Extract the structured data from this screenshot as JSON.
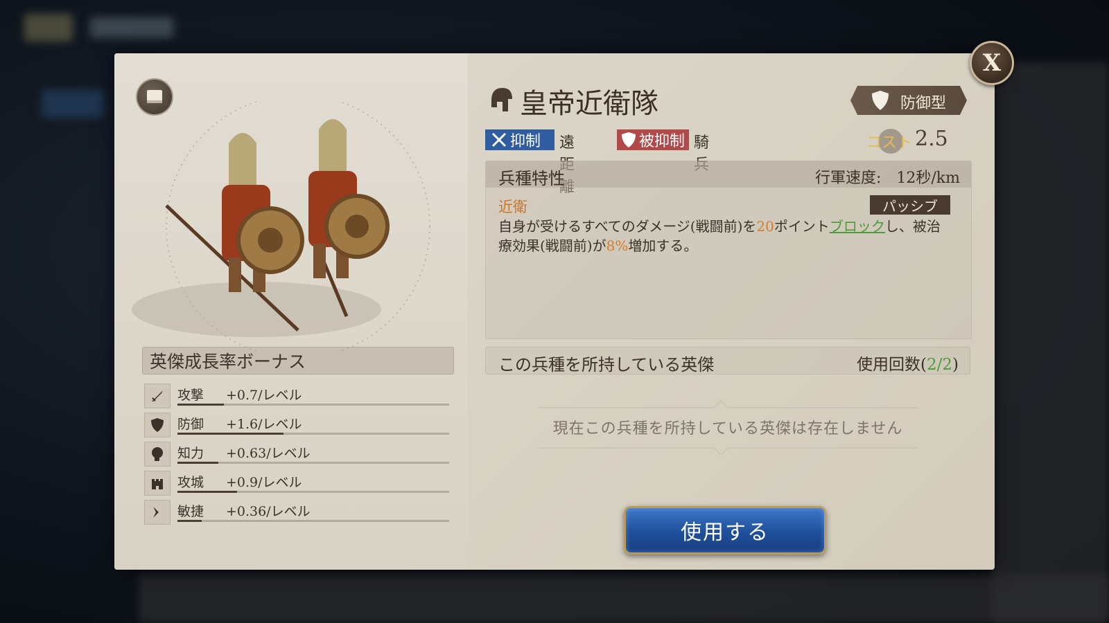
{
  "unit": {
    "name": "皇帝近衛隊",
    "type": "防御型",
    "tags": {
      "counter_label": "抑制",
      "counter_target": "遠距離",
      "countered_label": "被抑制",
      "countered_by": "騎兵"
    },
    "cost_label": "コスト",
    "cost_value": "2.5"
  },
  "traits": {
    "title": "兵種特性",
    "march_speed": "行軍速度:　12秒/km",
    "skill_name": "近衛",
    "skill_type": "パッシブ",
    "desc": {
      "p1": "自身が受けるすべてのダメージ(戦闘前)を",
      "v1": "20",
      "p2": "ポイント",
      "kw": "ブロック",
      "p3": "し、被治療効果(戦闘前)が",
      "v2": "8%",
      "p4": "増加する。"
    }
  },
  "growth": {
    "title": "英傑成長率ボーナス",
    "stats": [
      {
        "label": "攻撃",
        "value": "+0.7/レベル",
        "icon": "sword-icon",
        "fill": 0.17
      },
      {
        "label": "防御",
        "value": "+1.6/レベル",
        "icon": "shield-icon",
        "fill": 0.39
      },
      {
        "label": "知力",
        "value": "+0.63/レベル",
        "icon": "head-icon",
        "fill": 0.15
      },
      {
        "label": "攻城",
        "value": "+0.9/レベル",
        "icon": "castle-icon",
        "fill": 0.22
      },
      {
        "label": "敏捷",
        "value": "+0.36/レベル",
        "icon": "boot-icon",
        "fill": 0.09
      }
    ]
  },
  "owned": {
    "title": "この兵種を所持している英傑",
    "usage_prefix": "使用回数(",
    "usage_value": "2/2",
    "usage_suffix": ")",
    "empty_message": "現在この兵種を所持している英傑は存在しません"
  },
  "buttons": {
    "use": "使用する",
    "close": "X"
  },
  "colors": {
    "counter_tag": "#2f5da0",
    "countered_tag": "#b04a4a",
    "highlight_orange": "#d97a28",
    "highlight_green": "#4d9a3a",
    "cost_label": "#e3bb52",
    "use_button": "#2a5fb0"
  }
}
